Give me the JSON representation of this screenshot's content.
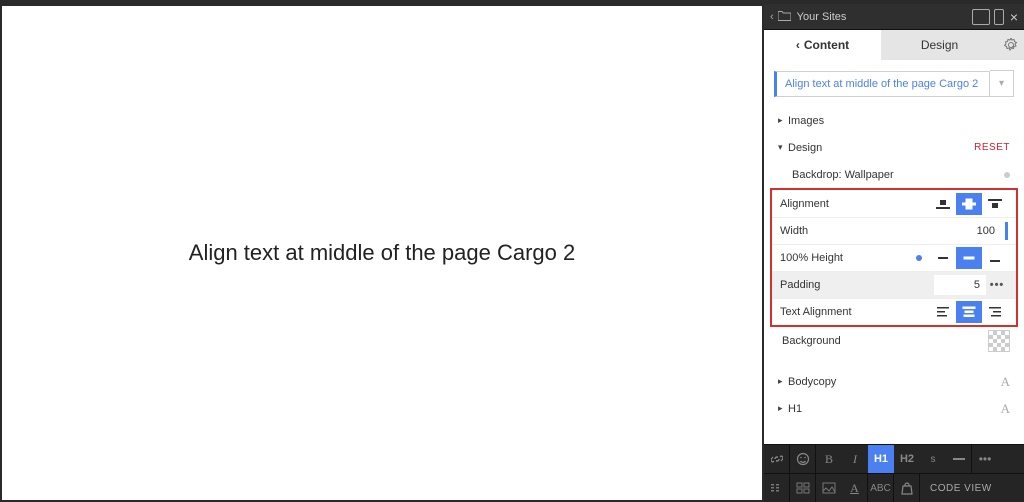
{
  "canvas": {
    "text": "Align text at middle of the page Cargo 2"
  },
  "topbar": {
    "title": "Your Sites"
  },
  "tabs": {
    "content": "Content",
    "design": "Design"
  },
  "page_chip": {
    "label": "Align text at middle of the page Cargo 2"
  },
  "sections": {
    "images": "Images",
    "design": "Design",
    "reset": "RESET",
    "backdrop": "Backdrop: Wallpaper",
    "background": "Background",
    "bodycopy": "Bodycopy",
    "h1": "H1"
  },
  "controls": {
    "alignment": {
      "label": "Alignment",
      "selected": 1
    },
    "width": {
      "label": "Width",
      "value": "100"
    },
    "height": {
      "label": "100% Height",
      "selected": 1
    },
    "padding": {
      "label": "Padding",
      "value": "5"
    },
    "text_align": {
      "label": "Text Alignment",
      "selected": 1
    }
  },
  "toolbar": {
    "bold": "B",
    "italic": "I",
    "h1": "H1",
    "h2": "H2",
    "s": "s",
    "code_view": "CODE VIEW"
  }
}
